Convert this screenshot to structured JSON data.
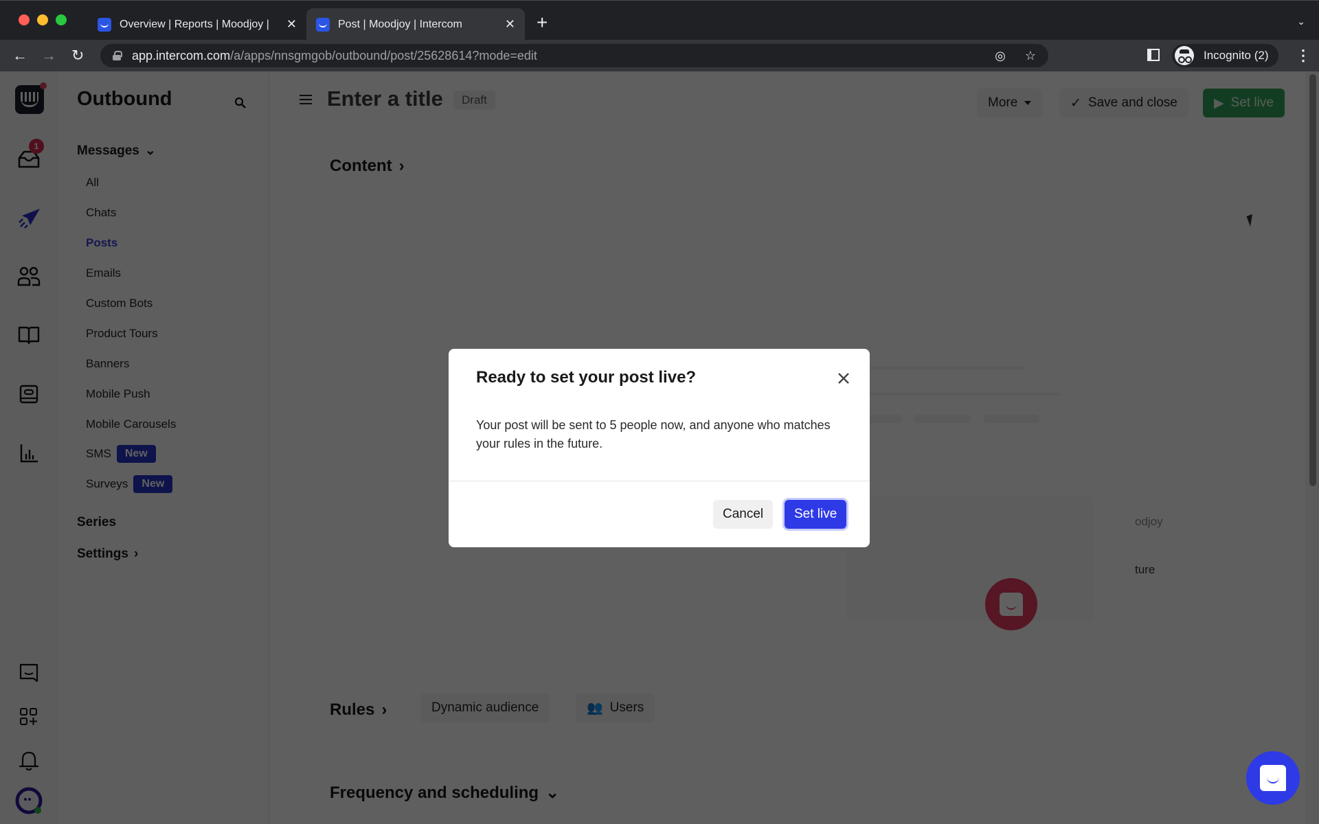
{
  "browser": {
    "tabs": [
      {
        "title": "Overview | Reports | Moodjoy |",
        "active": false
      },
      {
        "title": "Post | Moodjoy | Intercom",
        "active": true
      }
    ],
    "new_tab_label": "+",
    "url_host": "app.intercom.com",
    "url_path": "/a/apps/nnsgmgob/outbound/post/25628614?mode=edit",
    "profile_label": "Incognito (2)"
  },
  "rail": {
    "inbox_badge": "1",
    "icons": [
      "intercom-logo-icon",
      "inbox-icon",
      "outbound-icon",
      "contacts-icon",
      "articles-icon",
      "messenger-icon",
      "reports-icon",
      "conversations-icon",
      "apps-icon",
      "notifications-icon",
      "avatar"
    ]
  },
  "subnav": {
    "title": "Outbound",
    "messages_label": "Messages",
    "items": [
      {
        "label": "All"
      },
      {
        "label": "Chats"
      },
      {
        "label": "Posts",
        "active": true
      },
      {
        "label": "Emails"
      },
      {
        "label": "Custom Bots"
      },
      {
        "label": "Product Tours"
      },
      {
        "label": "Banners"
      },
      {
        "label": "Mobile Push"
      },
      {
        "label": "Mobile Carousels"
      },
      {
        "label": "SMS",
        "badge": "New"
      },
      {
        "label": "Surveys",
        "badge": "New"
      }
    ],
    "series_label": "Series",
    "settings_label": "Settings"
  },
  "header": {
    "title_placeholder": "Enter a title",
    "status": "Draft",
    "more_label": "More",
    "save_close_label": "Save and close",
    "set_live_label": "Set live"
  },
  "sections": {
    "content_label": "Content",
    "rules_label": "Rules",
    "dynamic_audience_label": "Dynamic audience",
    "users_label": "Users",
    "frequency_label": "Frequency and scheduling",
    "preview_partial_1": "odjoy",
    "preview_partial_2": "ture"
  },
  "modal": {
    "title": "Ready to set your post live?",
    "body": "Your post will be sent to 5 people now, and anyone who matches your rules in the future.",
    "cancel_label": "Cancel",
    "confirm_label": "Set live"
  },
  "colors": {
    "primary": "#2e3ae6",
    "set_live_green": "#33a15b",
    "active_nav": "#3b3bd6",
    "new_badge": "#2733c4"
  }
}
